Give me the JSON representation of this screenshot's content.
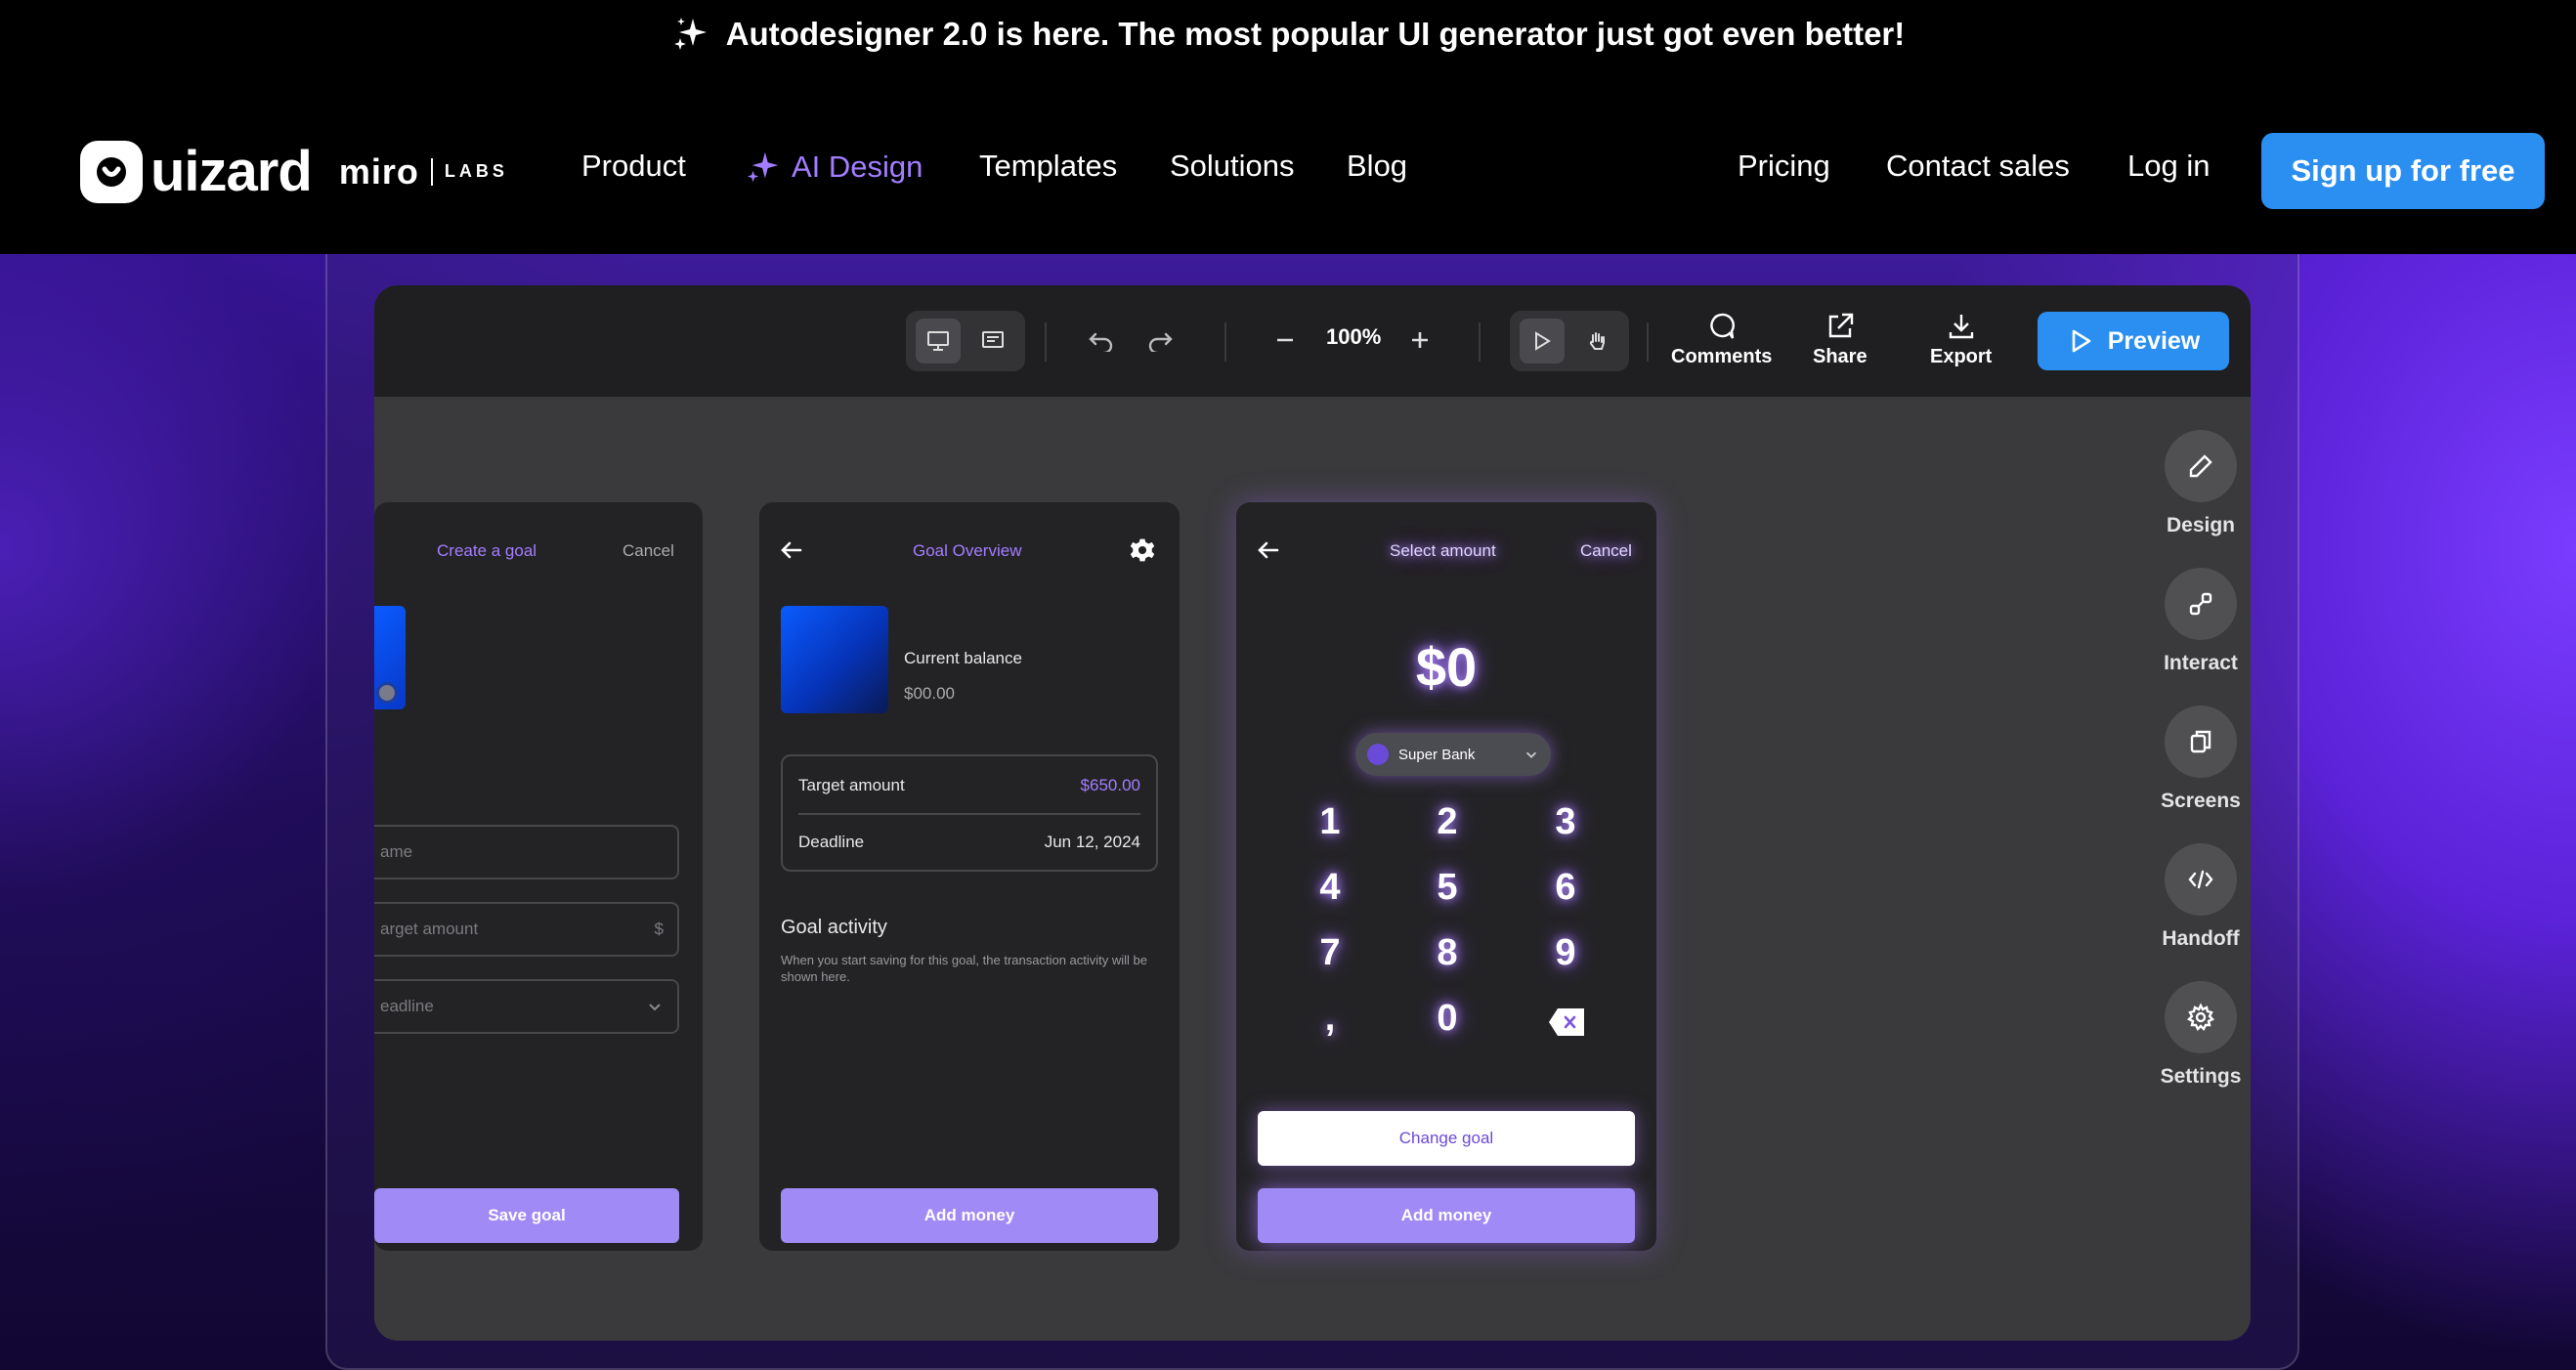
{
  "announcement": {
    "text": "Autodesigner 2.0 is here. The most popular UI generator just got even better!",
    "icon": "sparkles-icon"
  },
  "nav": {
    "logo_text": "uizard",
    "partner": "miro",
    "partner_sub": "LABS",
    "links": [
      "Product",
      "AI Design",
      "Templates",
      "Solutions",
      "Blog"
    ],
    "right_links": [
      "Pricing",
      "Contact sales",
      "Log in"
    ],
    "cta": "Sign up for free",
    "accent": "#a37dff",
    "cta_color": "#2a8ff0"
  },
  "toolbar": {
    "zoom": "100%",
    "actions": [
      "Comments",
      "Share",
      "Export"
    ],
    "preview": "Preview"
  },
  "rail": [
    "Design",
    "Interact",
    "Screens",
    "Handoff",
    "Settings"
  ],
  "screens": {
    "create_goal": {
      "title": "Create a goal",
      "cancel": "Cancel",
      "fields": [
        "ame",
        "arget amount",
        "eadline"
      ],
      "currency": "$",
      "save": "Save goal"
    },
    "overview": {
      "title": "Goal Overview",
      "balance_label": "Current balance",
      "balance_value": "$00.00",
      "target_label": "Target amount",
      "target_value": "$650.00",
      "deadline_label": "Deadline",
      "deadline_value": "Jun 12, 2024",
      "activity_title": "Goal activity",
      "activity_text": "When you start saving for this goal, the transaction activity will be shown here.",
      "add_money": "Add money"
    },
    "select_amount": {
      "title": "Select amount",
      "cancel": "Cancel",
      "amount": "$0",
      "bank": "Super Bank",
      "keys": [
        "1",
        "2",
        "3",
        "4",
        "5",
        "6",
        "7",
        "8",
        "9",
        ",",
        "0"
      ],
      "change_goal": "Change goal",
      "add_money": "Add money"
    }
  }
}
